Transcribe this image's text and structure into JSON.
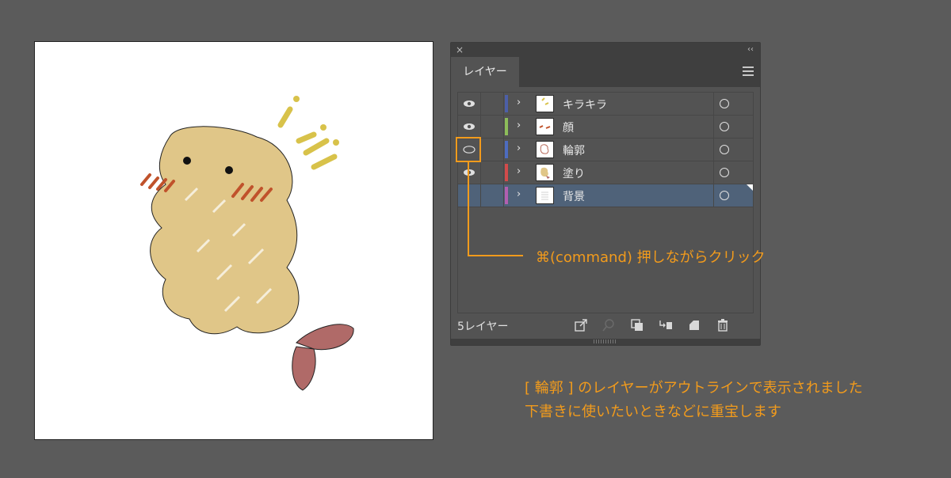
{
  "panel": {
    "close_glyph": "×",
    "collapse_glyph": "‹‹",
    "tab_label": "レイヤー",
    "layers": [
      {
        "name": "キラキラ",
        "visible": true,
        "color": "#4c5fa8",
        "icon": "eye-icon"
      },
      {
        "name": "顔",
        "visible": true,
        "color": "#8dbd5a",
        "icon": "eye-icon"
      },
      {
        "name": "輪郭",
        "visible": true,
        "outline_mode": true,
        "color": "#4d6cc0",
        "icon": "eye-outline-icon"
      },
      {
        "name": "塗り",
        "visible": true,
        "color": "#d24b4b",
        "icon": "eye-icon"
      },
      {
        "name": "背景",
        "visible": false,
        "selected": true,
        "color": "#b25fb0",
        "icon": "none"
      }
    ],
    "chevron_glyph": "›",
    "footer": {
      "layer_count": "5レイヤー",
      "icons": [
        "export-icon",
        "search-icon",
        "clipping-mask-icon",
        "move-selection-icon",
        "new-sublayer-icon",
        "trash-icon"
      ]
    }
  },
  "annotation": {
    "callout": "⌘(command) 押しながらクリック",
    "caption_line1": "[ 輪郭 ] のレイヤーがアウトラインで表示されました",
    "caption_line2": "下書きに使いたいときなどに重宝します",
    "accent_color": "#f29b1c"
  },
  "artwork": {
    "description_icon": "shrimp-fry-character-illustration"
  }
}
